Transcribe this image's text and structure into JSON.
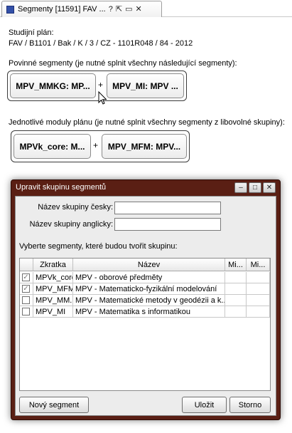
{
  "tab": {
    "title": "Segmenty  [11591] FAV ...",
    "close_glyph": "✕",
    "maximize_glyph": "▭",
    "detach_glyph": "⇱",
    "pin_glyph": "?"
  },
  "plan": {
    "label": "Studijní plán:",
    "value": "FAV / B1101 / Bak / K / 3 / CZ - 1101R048 / 84 - 2012"
  },
  "mandatory": {
    "label": "Povinné segmenty (je nutné splnit všechny následující segmenty):",
    "items": [
      "MPV_MMKG: MP...",
      "MPV_MI: MPV ..."
    ],
    "plus": "+"
  },
  "modules": {
    "label": "Jednotlivé moduly plánu (je nutné splnit všechny segmenty z libovolné skupiny):",
    "items": [
      "MPVk_core: M...",
      "MPV_MFM: MPV..."
    ],
    "plus": "+"
  },
  "dialog": {
    "title": "Upravit skupinu segmentů",
    "btn_min": "–",
    "btn_max": "□",
    "btn_close": "✕",
    "name_cz_label": "Název skupiny česky:",
    "name_cz_value": "",
    "name_en_label": "Název skupiny anglicky:",
    "name_en_value": "",
    "select_label": "Vyberte segmenty, které budou tvořit skupinu:",
    "columns": [
      "",
      "Zkratka",
      "Název",
      "Mi...",
      "Mi..."
    ],
    "rows": [
      {
        "checked": true,
        "code": "MPVk_core",
        "name": "MPV - oborové předměty"
      },
      {
        "checked": true,
        "code": "MPV_MFM",
        "name": "MPV - Matematicko-fyzikální modelování"
      },
      {
        "checked": false,
        "code": "MPV_MM...",
        "name": "MPV - Matematické metody v geodézii a k..."
      },
      {
        "checked": false,
        "code": "MPV_MI",
        "name": "MPV - Matematika s informatikou"
      }
    ],
    "btn_new": "Nový segment",
    "btn_save": "Uložit",
    "btn_cancel": "Storno"
  }
}
